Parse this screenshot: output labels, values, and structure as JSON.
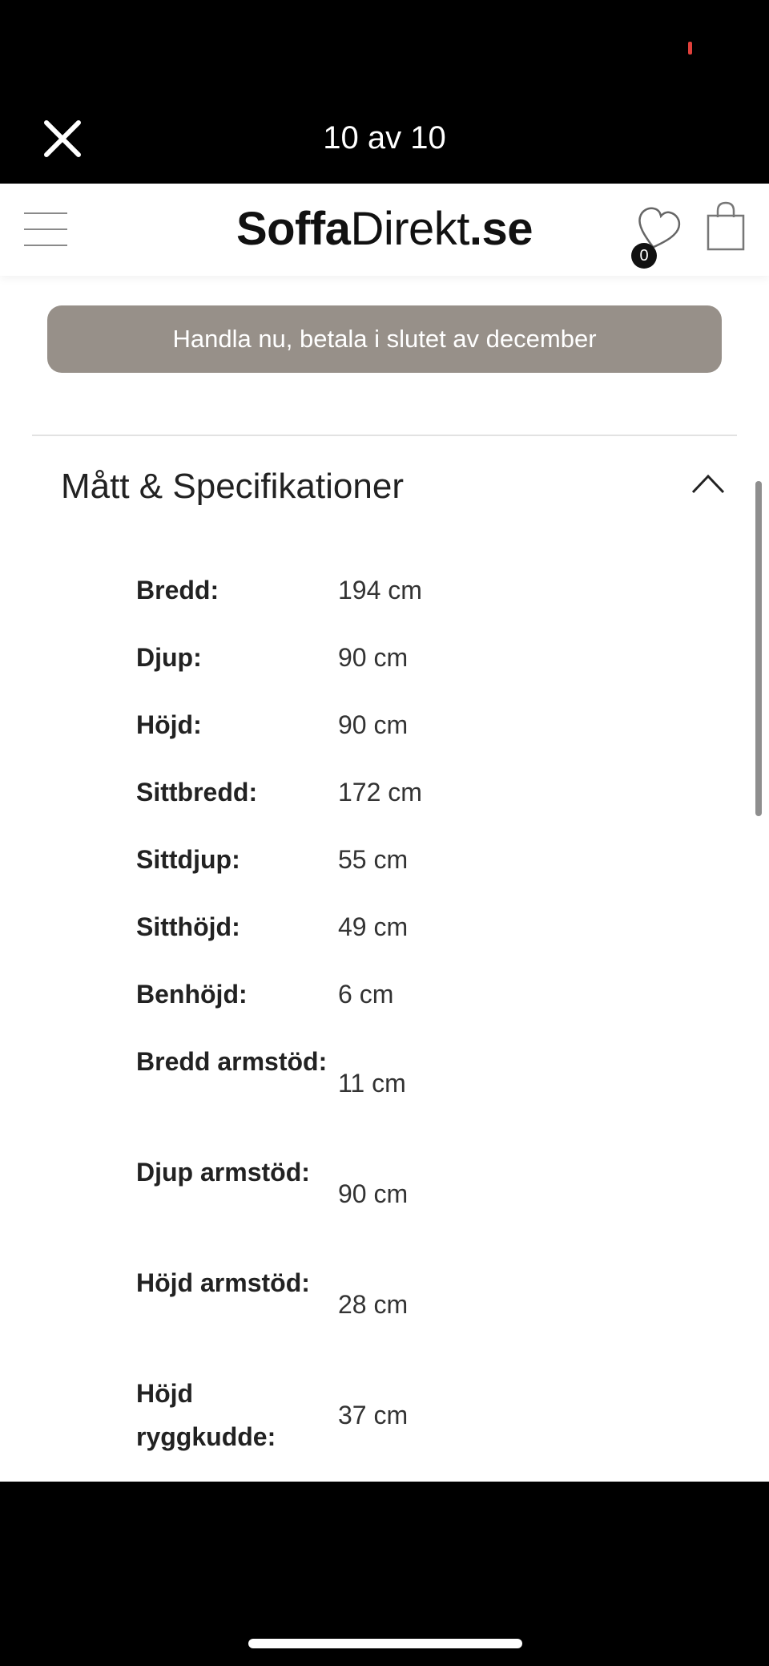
{
  "viewer": {
    "counter": "10 av 10",
    "close_icon": "close-icon",
    "status_dot_color": "#e0403b"
  },
  "site": {
    "logo_bold_1": "Soffa",
    "logo_regular": "Direkt",
    "logo_bold_2": ".se",
    "wishlist_count": "0",
    "icons": [
      "menu-icon",
      "heart-icon",
      "bag-icon"
    ]
  },
  "promo": {
    "text": "Handla nu, betala i slutet av december",
    "color": "#979089"
  },
  "specs": {
    "title": "Mått & Specifikationer",
    "expanded": true,
    "rows": [
      {
        "label": "Bredd:",
        "value": "194 cm"
      },
      {
        "label": "Djup:",
        "value": "90 cm"
      },
      {
        "label": "Höjd:",
        "value": "90 cm"
      },
      {
        "label": "Sittbredd:",
        "value": "172 cm"
      },
      {
        "label": "Sittdjup:",
        "value": "55 cm"
      },
      {
        "label": "Sitthöjd:",
        "value": "49 cm"
      },
      {
        "label": "Benhöjd:",
        "value": "6 cm"
      },
      {
        "label": "Bredd armstöd:",
        "value": "11 cm"
      },
      {
        "label": "Djup armstöd:",
        "value": "90 cm"
      },
      {
        "label": "Höjd armstöd:",
        "value": "28 cm"
      },
      {
        "label": "Höjd ryggkudde:",
        "value": "37 cm"
      }
    ]
  }
}
